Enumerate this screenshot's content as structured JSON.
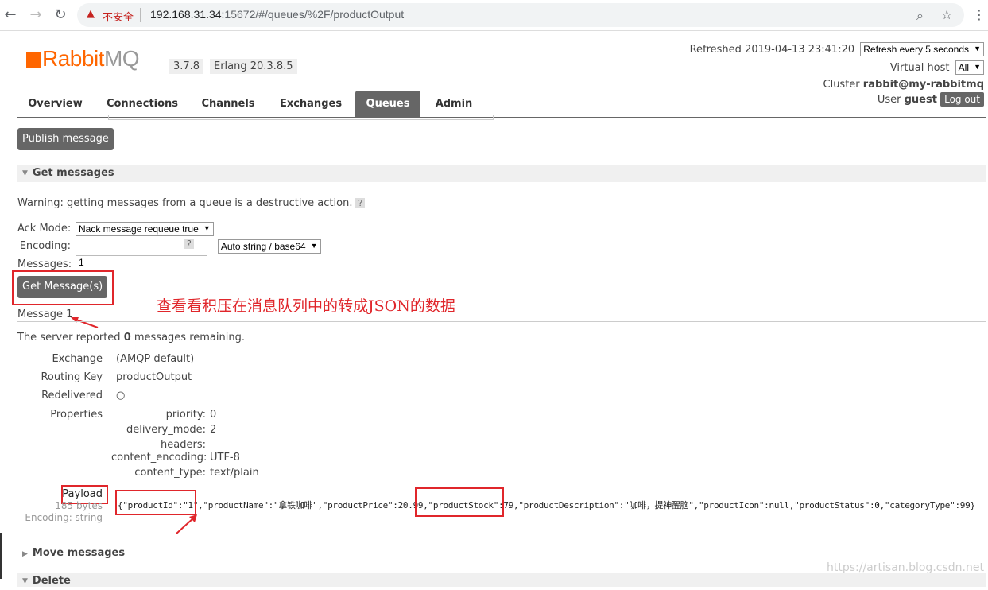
{
  "browser": {
    "insecure_label": "不安全",
    "url_host": "192.168.31.34",
    "url_rest": ":15672/#/queues/%2F/productOutput"
  },
  "header": {
    "logo_text": "Rabbit",
    "logo_mq": "MQ",
    "version": "3.7.8",
    "erlang": "Erlang 20.3.8.5",
    "refreshed": "Refreshed 2019-04-13 23:41:20",
    "refresh_option": "Refresh every 5 seconds",
    "virtual_host_label": "Virtual host",
    "virtual_host_value": "All",
    "cluster_label": "Cluster",
    "cluster_value": "rabbit@my-rabbitmq",
    "user_label": "User",
    "user_value": "guest",
    "logout_label": "Log out"
  },
  "tabs": [
    {
      "label": "Overview"
    },
    {
      "label": "Connections"
    },
    {
      "label": "Channels"
    },
    {
      "label": "Exchanges"
    },
    {
      "label": "Queues"
    },
    {
      "label": "Admin"
    }
  ],
  "publish_button": "Publish message",
  "get_messages": {
    "title": "Get messages",
    "warning": "Warning: getting messages from a queue is a destructive action.",
    "help": "?",
    "ack_mode_label": "Ack Mode:",
    "ack_mode_value": "Nack message requeue true",
    "encoding_label": "Encoding:",
    "encoding_value": "Auto string / base64",
    "messages_label": "Messages:",
    "messages_value": "1",
    "get_button": "Get Message(s)"
  },
  "annotation": "查看看积压在消息队列中的转成JSON的数据",
  "message": {
    "title": "Message 1",
    "server_reported_prefix": "The server reported ",
    "server_reported_count": "0",
    "server_reported_suffix": " messages remaining.",
    "exchange_label": "Exchange",
    "exchange_value": "(AMQP default)",
    "routing_key_label": "Routing Key",
    "routing_key_value": "productOutput",
    "redelivered_label": "Redelivered",
    "redelivered_value": "○",
    "properties_label": "Properties",
    "properties": [
      {
        "key": "priority:",
        "value": "0"
      },
      {
        "key": "delivery_mode:",
        "value": "2"
      },
      {
        "key": "headers:",
        "value": ""
      },
      {
        "key": "content_encoding:",
        "value": "UTF-8"
      },
      {
        "key": "content_type:",
        "value": "text/plain"
      }
    ],
    "payload_label": "Payload",
    "payload_size": "185 bytes",
    "payload_encoding": "Encoding: string",
    "payload": "{\"productId\":\"1\",\"productName\":\"拿铁咖啡\",\"productPrice\":20.99,\"productStock\":79,\"productDescription\":\"咖啡，提神醒脑\",\"productIcon\":null,\"productStatus\":0,\"categoryType\":99}"
  },
  "move_messages": "Move messages",
  "delete": "Delete",
  "watermark": "https://artisan.blog.csdn.net"
}
